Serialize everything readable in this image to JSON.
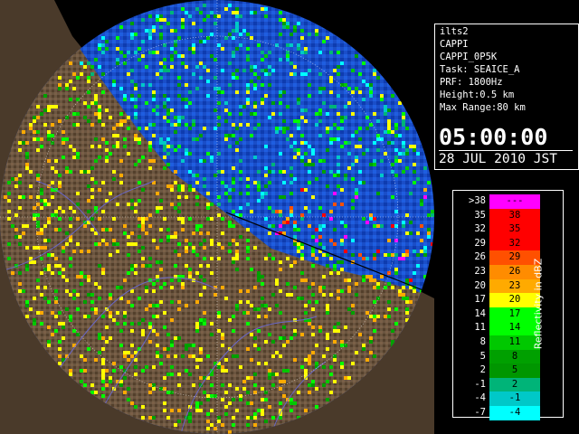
{
  "radar": {
    "site": "ilts2",
    "product": "CAPPI",
    "product_name": "CAPPI_0P5K",
    "task": "Task: SEAICE_A",
    "prf": "PRF: 1800Hz",
    "height": "Height:0.5 km",
    "max_range": "Max Range:80 km",
    "time": "05:00:00",
    "date": "28 JUL 2010 JST"
  },
  "legend": {
    "title": "Reflectivity in dBZ",
    "rows": [
      {
        "low": ">38",
        "high": "---",
        "color": "#ff00ff"
      },
      {
        "low": "35",
        "high": "38",
        "color": "#ff0000"
      },
      {
        "low": "32",
        "high": "35",
        "color": "#ff0000"
      },
      {
        "low": "29",
        "high": "32",
        "color": "#ff0000"
      },
      {
        "low": "26",
        "high": "29",
        "color": "#ff5000"
      },
      {
        "low": "23",
        "high": "26",
        "color": "#ff8c00"
      },
      {
        "low": "20",
        "high": "23",
        "color": "#ffaa00"
      },
      {
        "low": "17",
        "high": "20",
        "color": "#ffff00"
      },
      {
        "low": "14",
        "high": "17",
        "color": "#00ff00"
      },
      {
        "low": "11",
        "high": "14",
        "color": "#00ff00"
      },
      {
        "low": "8",
        "high": "11",
        "color": "#00c800"
      },
      {
        "low": "5",
        "high": "8",
        "color": "#00a000"
      },
      {
        "low": "2",
        "high": "5",
        "color": "#009600"
      },
      {
        "low": "-1",
        "high": "2",
        "color": "#00b478"
      },
      {
        "low": "-4",
        "high": "-1",
        "color": "#00c8c8"
      },
      {
        "low": "-7",
        "high": "-4",
        "color": "#00ffff"
      }
    ]
  },
  "map": {
    "sea_color": "#1e50c8",
    "land_color": "#6b5640",
    "range_ring_color": "#ffffff",
    "river_color": "#6a6ad8"
  }
}
